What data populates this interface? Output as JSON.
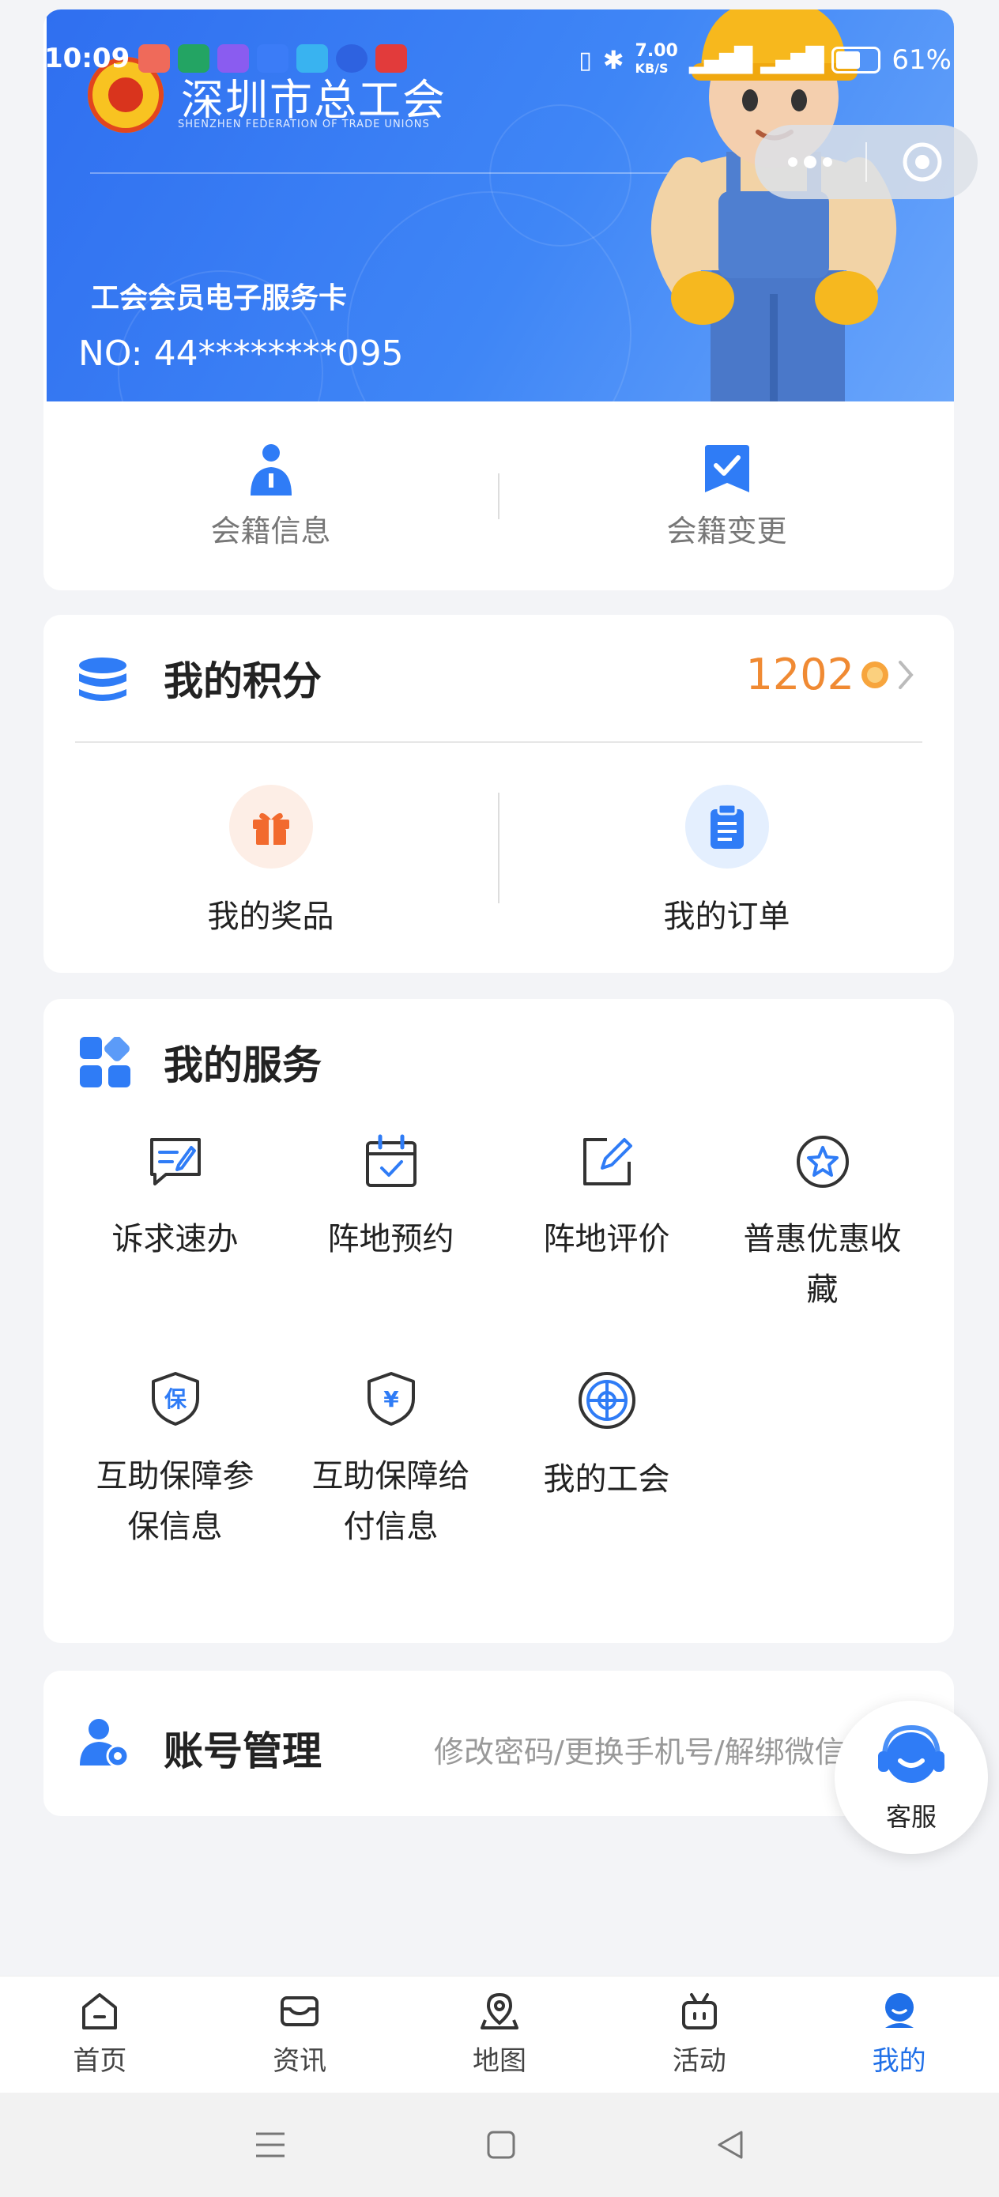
{
  "status_bar": {
    "time": "10:09",
    "network_speed": "7.00",
    "network_unit": "KB/S",
    "battery": "61%"
  },
  "member_card": {
    "org_name": "深圳市总工会",
    "org_name_en": "SHENZHEN FEDERATION OF TRADE UNIONS",
    "card_title": "工会会员电子服务卡",
    "card_number": "NO: 44********095",
    "actions": [
      {
        "label": "会籍信息",
        "icon": "person-icon"
      },
      {
        "label": "会籍变更",
        "icon": "check-badge-icon"
      }
    ]
  },
  "points": {
    "title": "我的积分",
    "value": "1202",
    "actions": [
      {
        "label": "我的奖品",
        "icon": "gift-icon"
      },
      {
        "label": "我的订单",
        "icon": "clipboard-icon"
      }
    ]
  },
  "services": {
    "title": "我的服务",
    "items": [
      {
        "label": "诉求速办",
        "icon": "chat-edit-icon"
      },
      {
        "label": "阵地预约",
        "icon": "calendar-check-icon"
      },
      {
        "label": "阵地评价",
        "icon": "edit-icon"
      },
      {
        "label": "普惠优惠收藏",
        "icon": "star-circle-icon"
      },
      {
        "label": "互助保障参保信息",
        "icon": "shield-bao-icon"
      },
      {
        "label": "互助保障给付信息",
        "icon": "shield-yen-icon"
      },
      {
        "label": "我的工会",
        "icon": "union-logo-icon"
      }
    ]
  },
  "account": {
    "title": "账号管理",
    "hint": "修改密码/更换手机号/解绑微信号"
  },
  "customer_service": {
    "label": "客服"
  },
  "tabbar": {
    "tabs": [
      {
        "label": "首页",
        "icon": "home-icon"
      },
      {
        "label": "资讯",
        "icon": "news-icon"
      },
      {
        "label": "地图",
        "icon": "map-pin-icon"
      },
      {
        "label": "活动",
        "icon": "activity-icon"
      },
      {
        "label": "我的",
        "icon": "user-icon",
        "active": true
      }
    ]
  },
  "colors": {
    "brand_blue": "#1f6fe8",
    "points_orange": "#f08a33",
    "background": "#f3f4f7"
  }
}
